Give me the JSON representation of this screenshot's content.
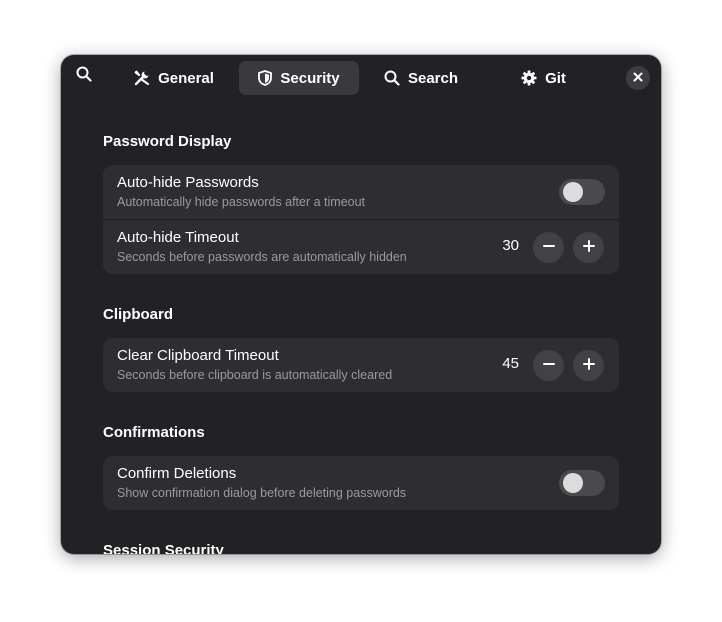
{
  "header": {
    "search_icon": "search-icon",
    "tabs": [
      {
        "label": "General",
        "icon": "tools-icon",
        "active": false
      },
      {
        "label": "Security",
        "icon": "shield-icon",
        "active": true
      },
      {
        "label": "Search",
        "icon": "search-icon",
        "active": false
      },
      {
        "label": "Git",
        "icon": "gear-icon",
        "active": false
      }
    ],
    "close_icon": "close-icon"
  },
  "sections": [
    {
      "title": "Password Display",
      "rows": [
        {
          "title": "Auto-hide Passwords",
          "subtitle": "Automatically hide passwords after a timeout",
          "control": "switch",
          "on": false
        },
        {
          "title": "Auto-hide Timeout",
          "subtitle": "Seconds before passwords are automatically hidden",
          "control": "spin",
          "value": "30"
        }
      ]
    },
    {
      "title": "Clipboard",
      "rows": [
        {
          "title": "Clear Clipboard Timeout",
          "subtitle": "Seconds before clipboard is automatically cleared",
          "control": "spin",
          "value": "45"
        }
      ]
    },
    {
      "title": "Confirmations",
      "rows": [
        {
          "title": "Confirm Deletions",
          "subtitle": "Show confirmation dialog before deleting passwords",
          "control": "switch",
          "on": false
        }
      ]
    },
    {
      "title": "Session Security",
      "rows": []
    }
  ],
  "colors": {
    "window_bg": "#222226",
    "card_bg": "#2e2e32",
    "active_tab_bg": "#3a3a3e",
    "subtitle_text": "#9a9a9e"
  }
}
